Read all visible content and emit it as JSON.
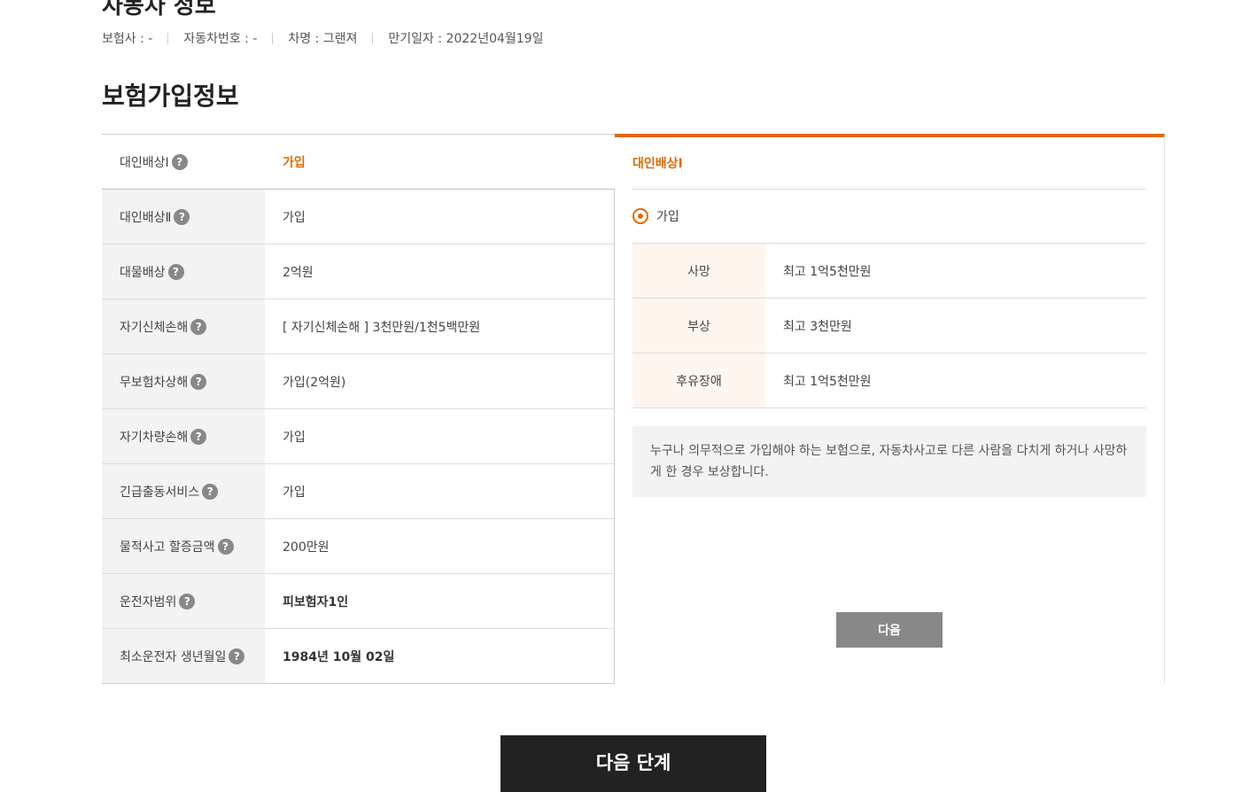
{
  "vehicle_info": {
    "title": "자동차 정보",
    "insurer": "보험사 : -",
    "plate": "자동차번호 : -",
    "car_name": "차명 : 그랜져",
    "expiry": "만기일자 : 2022년04월19일"
  },
  "section_title": "보험가입정보",
  "coverage_rows": [
    {
      "label": "대인배상Ⅰ",
      "value": "가입"
    },
    {
      "label": "대인배상Ⅱ",
      "value": "가입"
    },
    {
      "label": "대물배상",
      "value": "2억원"
    },
    {
      "label": "자기신체손해",
      "value": "[ 자기신체손해 ]  3천만원/1천5백만원"
    },
    {
      "label": "무보험차상해",
      "value": "가입(2억원)"
    },
    {
      "label": "자기차량손해",
      "value": "가입"
    },
    {
      "label": "긴급출동서비스",
      "value": "가입"
    },
    {
      "label": "물적사고 할증금액",
      "value": "200만원"
    },
    {
      "label": "운전자범위",
      "value": "피보험자1인"
    },
    {
      "label": "최소운전자 생년월일",
      "value": "1984년 10월 02일"
    }
  ],
  "help_icon_glyph": "?",
  "detail_panel": {
    "title": "대인배상Ⅰ",
    "option_label": "가입",
    "items": [
      {
        "label": "사망",
        "value": "최고 1억5천만원"
      },
      {
        "label": "부상",
        "value": "최고 3천만원"
      },
      {
        "label": "후유장애",
        "value": "최고 1억5천만원"
      }
    ],
    "description": "누구나 의무적으로 가입해야 하는 보험으로, 자동차사고로 다른 사람을 다치게 하거나 사망하게 한 경우 보상합니다.",
    "next_label": "다음"
  },
  "next_step_label": "다음 단계",
  "colors": {
    "accent": "#e06a00",
    "dark_button": "#222222",
    "gray_button": "#888888"
  }
}
